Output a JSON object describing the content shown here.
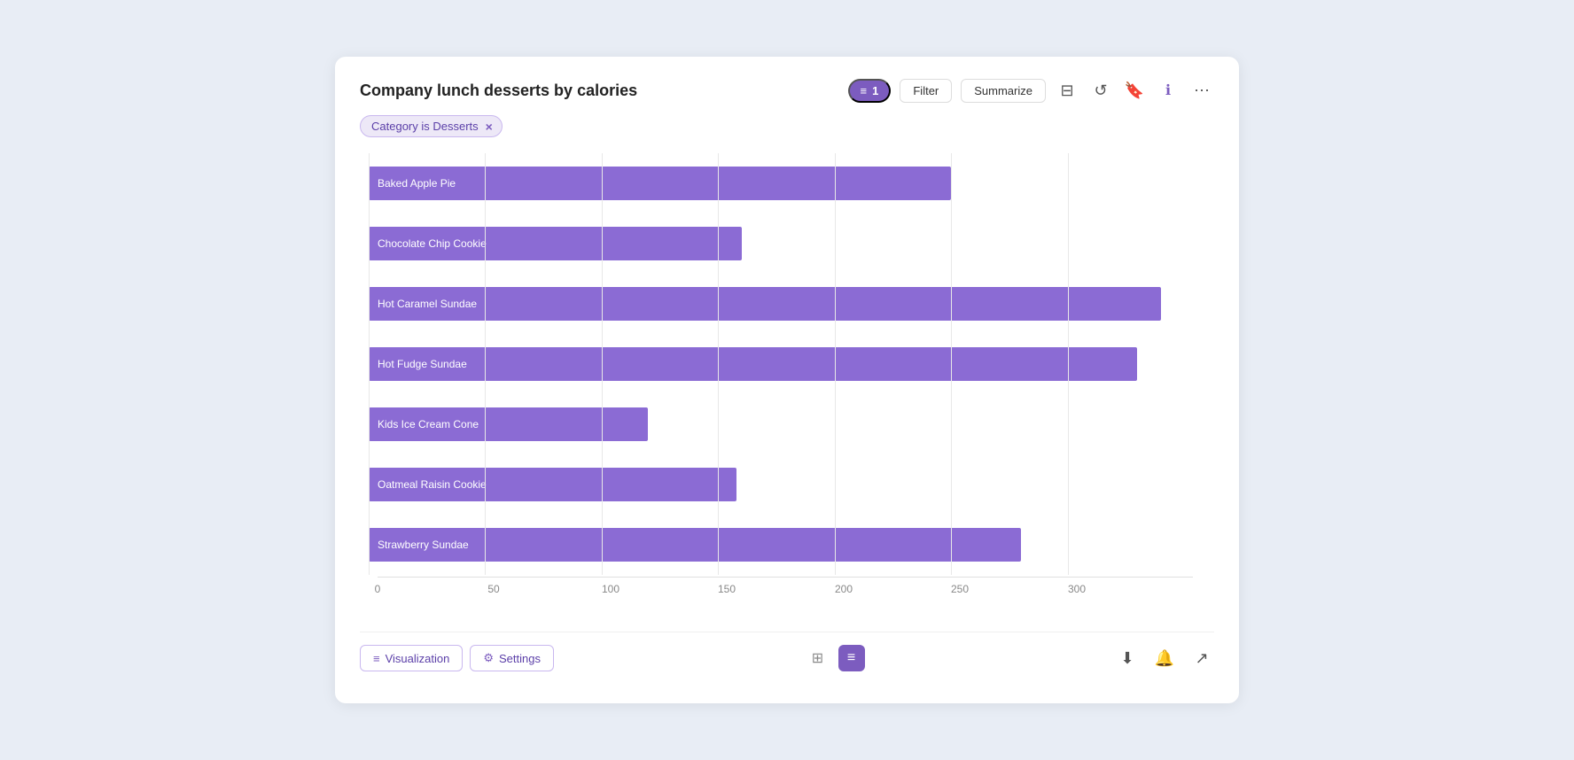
{
  "header": {
    "title": "Company lunch desserts by calories",
    "filter_count": "1",
    "filter_label": "Filter",
    "summarize_label": "Summarize"
  },
  "filter_tag": {
    "label": "Category is Desserts",
    "close": "×"
  },
  "chart": {
    "bars": [
      {
        "label": "Baked Apple Pie",
        "value": 250,
        "max": 350
      },
      {
        "label": "Chocolate Chip Cookie",
        "value": 160,
        "max": 350
      },
      {
        "label": "Hot Caramel Sundae",
        "value": 340,
        "max": 350
      },
      {
        "label": "Hot Fudge Sundae",
        "value": 330,
        "max": 350
      },
      {
        "label": "Kids Ice Cream Cone",
        "value": 120,
        "max": 350
      },
      {
        "label": "Oatmeal Raisin Cookie",
        "value": 158,
        "max": 350
      },
      {
        "label": "Strawberry Sundae",
        "value": 280,
        "max": 350
      }
    ],
    "x_axis_ticks": [
      "0",
      "50",
      "100",
      "150",
      "200",
      "250",
      "300"
    ],
    "x_axis_values": [
      0,
      50,
      100,
      150,
      200,
      250,
      300
    ],
    "max_value": 350
  },
  "footer": {
    "visualization_label": "Visualization",
    "settings_label": "Settings"
  },
  "icons": {
    "filter_icon": "≡",
    "gear_icon": "⚙",
    "grid_icon": "⊞",
    "chart_icon": "≡",
    "download_icon": "⬇",
    "bell_icon": "🔔",
    "share_icon": "↗",
    "info_icon": "ℹ",
    "bookmark_icon": "🔖",
    "refresh_icon": "↺",
    "more_icon": "⋯"
  }
}
